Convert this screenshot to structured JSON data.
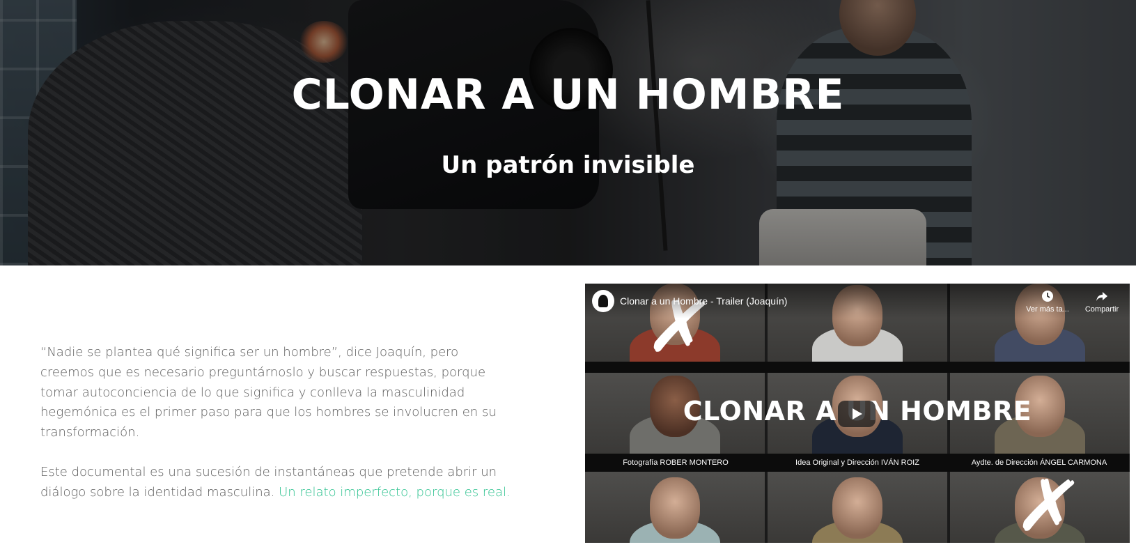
{
  "hero": {
    "title": "CLONAR A UN HOMBRE",
    "subtitle": "Un patrón invisible"
  },
  "content": {
    "paragraph1": "“Nadie se plantea qué significa ser un hombre”, dice Joaquín, pero creemos que es necesario preguntárnoslo y buscar respuestas, porque tomar autoconciencia de lo que significa y conlleva la masculinidad hegemónica es el primer paso para que los hombres se involucren en su transformación.",
    "paragraph2_text": "Este documental es una sucesión de instantáneas que pretende abrir un diálogo sobre la identidad masculina.",
    "paragraph2_link": "Un relato imperfecto, porque es real.",
    "accent_color": "#2ec28f"
  },
  "video": {
    "title": "Clonar a un Hombre - Trailer (Joaquín)",
    "watch_later": "Ver más ta...",
    "share": "Compartir",
    "overlay_title": "CLONAR A UN HOMBRE",
    "credits": [
      "Fotografía ROBER MONTERO",
      "Idea Original y Dirección IVÁN ROIZ",
      "Aydte. de Dirección ÁNGEL CARMONA"
    ],
    "icons": {
      "watch_later": "clock-icon",
      "share": "share-arrow-icon",
      "play": "play-icon",
      "channel": "channel-avatar"
    }
  }
}
